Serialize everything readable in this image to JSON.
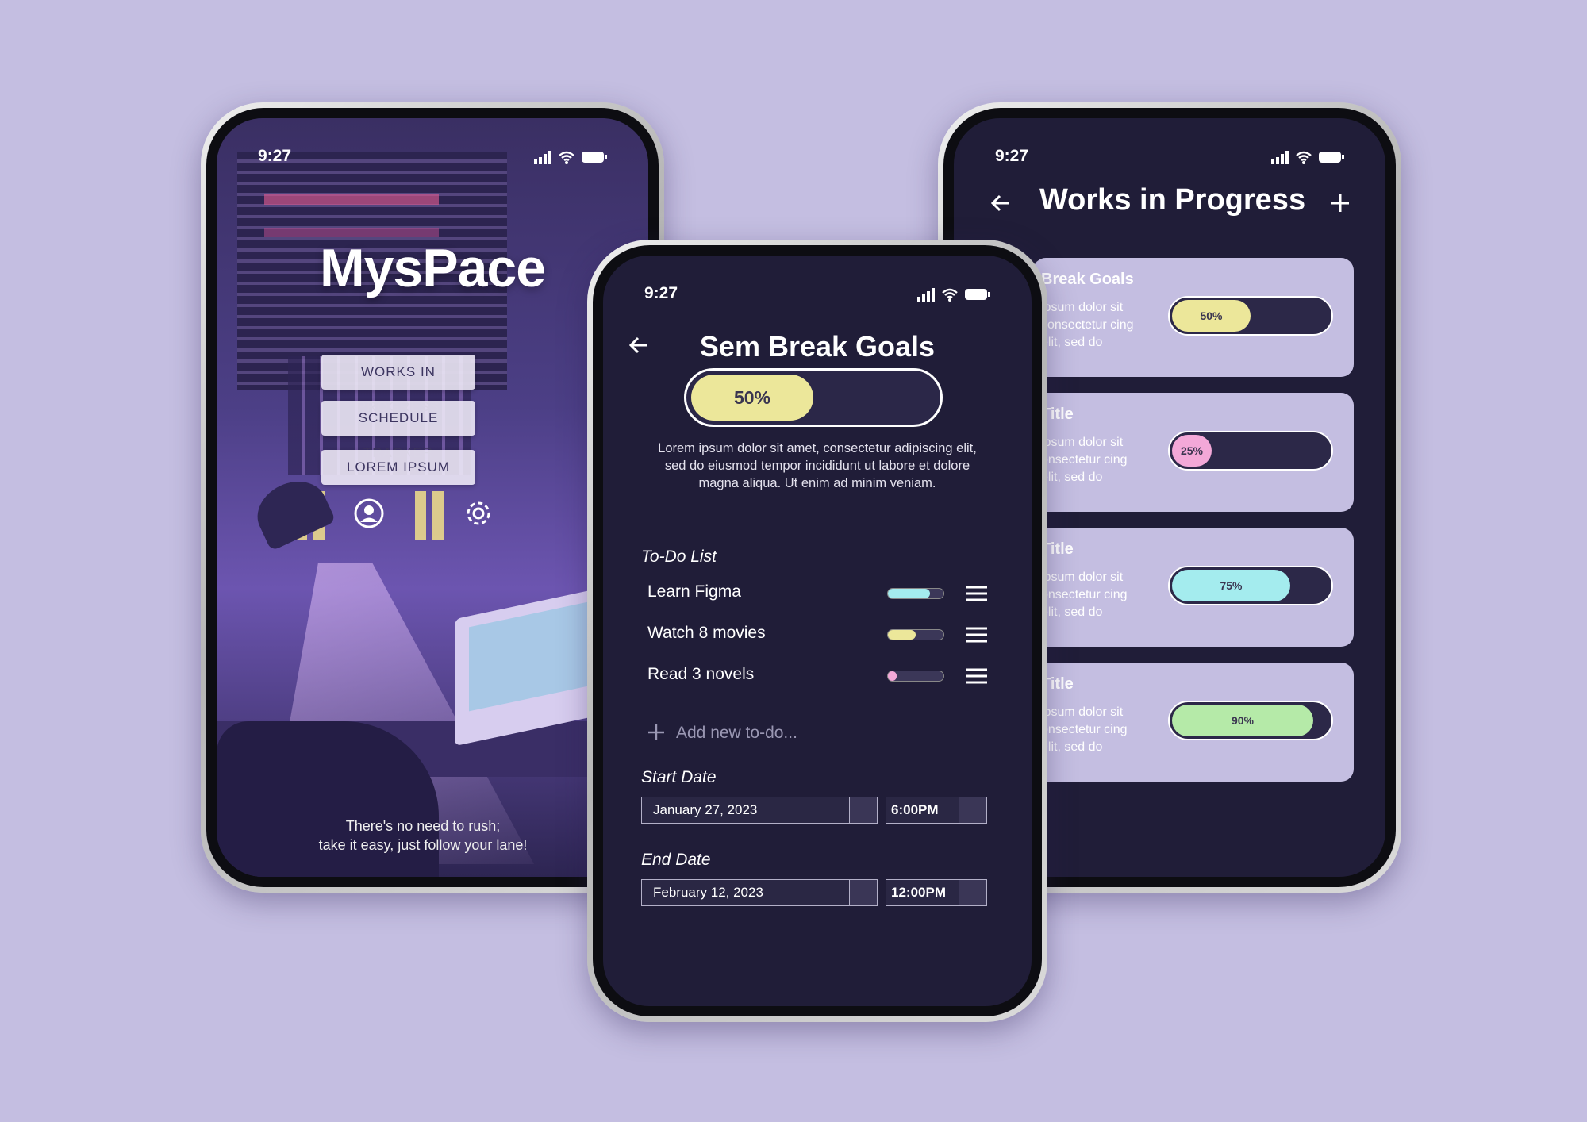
{
  "phone_left": {
    "time": "9:27",
    "brand": "MysPace",
    "menu": [
      "WORKS IN PROGRESS",
      "SCHEDULE TRACKER",
      "LOREM IPSUM"
    ],
    "quote_line1": "There's no need to rush;",
    "quote_line2": "take it easy, just follow your lane!"
  },
  "phone_middle": {
    "time": "9:27",
    "title": "Sem Break Goals",
    "progress": {
      "value": 0.5,
      "label": "50%",
      "color": "#ece79a"
    },
    "description": "Lorem ipsum dolor sit amet, consectetur adipiscing elit, sed do eiusmod tempor incididunt ut labore et dolore magna aliqua. Ut enim ad minim veniam.",
    "todo_heading": "To-Do List",
    "todos": [
      {
        "label": "Learn Figma",
        "progress": 0.75,
        "color": "#a4ecee"
      },
      {
        "label": "Watch 8 movies",
        "progress": 0.5,
        "color": "#ece79a"
      },
      {
        "label": "Read 3 novels",
        "progress": 0.15,
        "color": "#f3a8d8"
      }
    ],
    "add_todo_placeholder": "Add new to-do...",
    "start_heading": "Start Date",
    "start_date": "January 27, 2023",
    "start_time": "6:00PM",
    "end_heading": "End Date",
    "end_date": "February 12, 2023",
    "end_time": "12:00PM"
  },
  "phone_right": {
    "time": "9:27",
    "title": "Works in Progress",
    "cards": [
      {
        "title": "Break Goals",
        "body": "ipsum dolor sit consectetur cing elit, sed do",
        "progress": 0.5,
        "label": "50%",
        "color": "#ece79a"
      },
      {
        "title": "Title",
        "body": "ipsum dolor sit onsectetur cing elit, sed do",
        "progress": 0.25,
        "label": "25%",
        "color": "#f3a8d8"
      },
      {
        "title": "Title",
        "body": "ipsum dolor sit onsectetur cing elit, sed do",
        "progress": 0.75,
        "label": "75%",
        "color": "#a4ecee"
      },
      {
        "title": "Title",
        "body": "ipsum dolor sit onsectetur cing elit, sed do",
        "progress": 0.9,
        "label": "90%",
        "color": "#b5eaa8"
      }
    ]
  }
}
